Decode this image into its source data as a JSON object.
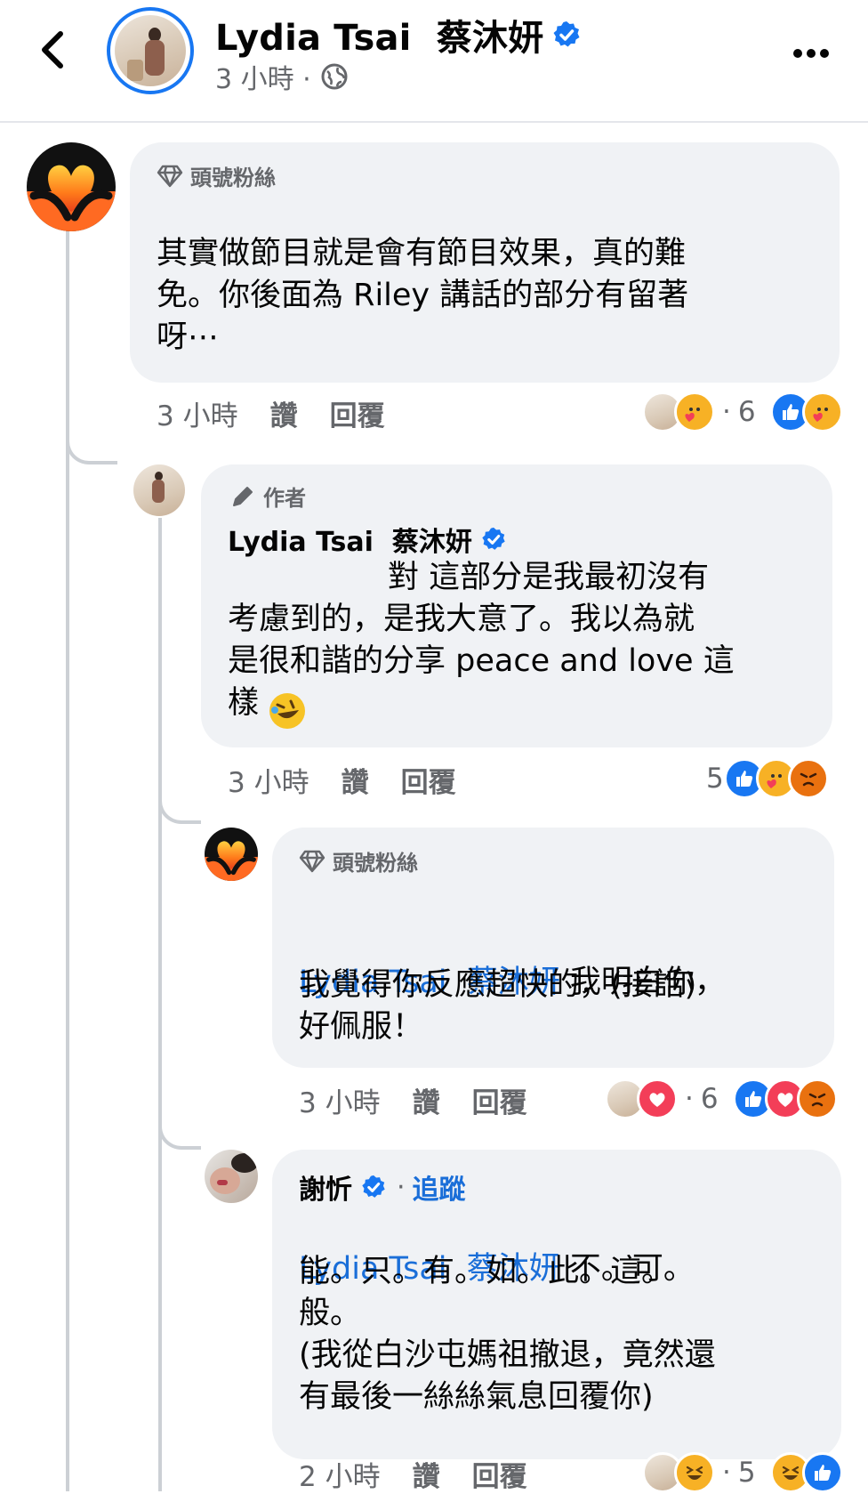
{
  "header": {
    "name": "Lydia Tsai  蔡沐妍",
    "time": "3 小時 ·"
  },
  "comments": [
    {
      "badge": "頭號粉絲",
      "text": "其實做節目就是會有節目效果，真的難\n免。你後面為 Riley 講話的部分有留著\n呀⋯",
      "time": "3 小時",
      "like": "讚",
      "reply": "回覆",
      "reaction_count": "6"
    },
    {
      "badge": "作者",
      "author": "Lydia Tsai  蔡沐妍",
      "text": "對 這部分是我最初沒有\n考慮到的，是我大意了。我以為就\n是很和諧的分享 peace and love 這\n樣",
      "time": "3 小時",
      "like": "讚",
      "reply": "回覆",
      "reaction_count": "5"
    },
    {
      "badge": "頭號粉絲",
      "mention": "Lydia Tsai  蔡沐妍",
      "text_first": " 我明白你，",
      "text_rest": "我覺得你反應超快的，(接話)\n好佩服！",
      "time": "3 小時",
      "like": "讚",
      "reply": "回覆",
      "reaction_count": "6"
    },
    {
      "author": "謝忻",
      "follow": "追蹤",
      "mention": "Lydia Tsai  蔡沐妍",
      "text_first": " 不。可。",
      "text_rest": "能。只。有。如。此。這。\n般。\n(我從白沙屯媽祖撤退，竟然還\n有最後一絲絲氣息回覆你)",
      "time": "2 小時",
      "like": "讚",
      "reply": "回覆",
      "reaction_count": "5"
    }
  ],
  "icons": {
    "back": "chevron-left-icon",
    "globe": "globe-icon",
    "more": "more-dots-icon",
    "diamond": "diamond-icon",
    "pen": "pen-icon",
    "verified": "verified-badge-icon"
  },
  "colors": {
    "accent": "#1877f2",
    "mention": "#1a6ed8",
    "bubble": "#f0f2f5",
    "muted": "#65676b"
  }
}
